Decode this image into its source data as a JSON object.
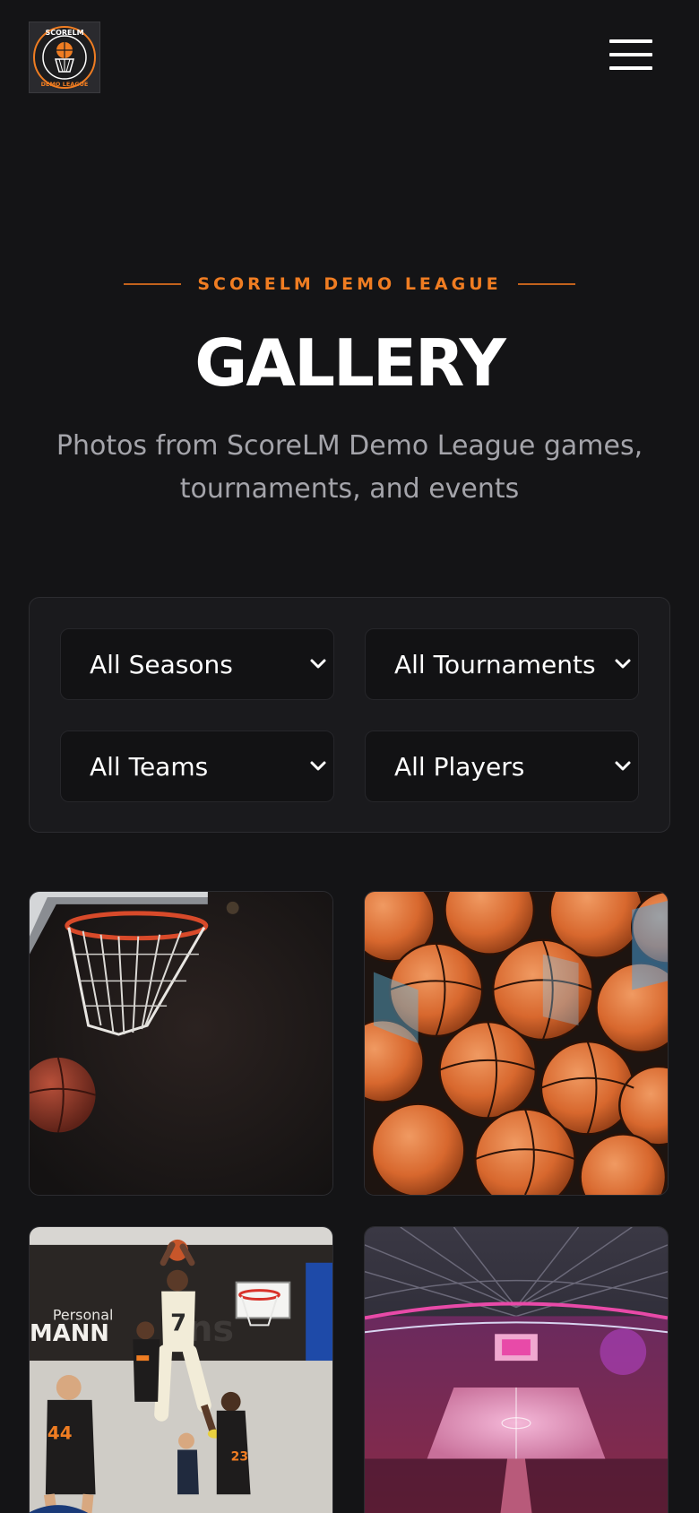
{
  "header": {
    "logo_top_text": "SCORELM",
    "logo_bottom_text": "DEMO LEAGUE",
    "menu_icon": "hamburger-menu-icon"
  },
  "hero": {
    "eyebrow": "SCORELM DEMO LEAGUE",
    "title": "GALLERY",
    "subtitle": "Photos from ScoreLM Demo League games, tournaments, and events"
  },
  "filters": {
    "season": "All Seasons",
    "tournament": "All Tournaments",
    "team": "All Teams",
    "player": "All Players",
    "chevron_icon": "chevron-down-icon"
  },
  "gallery": {
    "photos": [
      {
        "subject": "basketball-hoop-photo"
      },
      {
        "subject": "basketballs-pile-photo"
      },
      {
        "subject": "players-dunk-photo"
      },
      {
        "subject": "arena-crowd-photo"
      }
    ],
    "photo3_banner_text": "Personal",
    "photo3_banner_brand": "MANN",
    "photo3_jersey_number": "7"
  },
  "colors": {
    "background": "#141416",
    "accent": "#f07d22",
    "panel": "#1a1a1d",
    "muted_text": "#a4a4aa"
  }
}
